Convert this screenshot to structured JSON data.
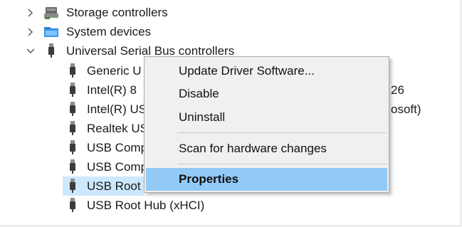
{
  "tree": {
    "top_partial_label": "",
    "storage_controllers": {
      "label": "Storage controllers",
      "chevron": "chevron-right-icon",
      "icon": "storage-controller-icon"
    },
    "system_devices": {
      "label": "System devices",
      "chevron": "chevron-right-icon",
      "icon": "system-devices-icon"
    },
    "usb_controllers": {
      "label": "Universal Serial Bus controllers",
      "chevron": "chevron-down-icon",
      "icon": "usb-plug-icon"
    },
    "children": [
      {
        "label": "Generic U",
        "overflow": "",
        "icon": "usb-plug-icon"
      },
      {
        "label": "Intel(R) 8",
        "overflow": "26",
        "icon": "usb-plug-icon"
      },
      {
        "label": "Intel(R) US",
        "overflow": "osoft)",
        "icon": "usb-plug-icon"
      },
      {
        "label": "Realtek US",
        "overflow": "",
        "icon": "usb-plug-icon"
      },
      {
        "label": "USB Comp",
        "overflow": "",
        "icon": "usb-plug-icon"
      },
      {
        "label": "USB Comp",
        "overflow": "",
        "icon": "usb-plug-icon"
      },
      {
        "label": "USB Root",
        "overflow": "",
        "icon": "usb-plug-icon",
        "selected": true
      },
      {
        "label": "USB Root Hub (xHCI)",
        "overflow": "",
        "icon": "usb-plug-icon"
      }
    ]
  },
  "context_menu": {
    "items": [
      {
        "label": "Update Driver Software..."
      },
      {
        "label": "Disable"
      },
      {
        "label": "Uninstall"
      },
      {
        "label": "Scan for hardware changes"
      },
      {
        "label": "Properties",
        "highlighted": true
      }
    ]
  },
  "colors": {
    "selection_bg": "#cce8ff",
    "menu_bg": "#f0f0f0",
    "menu_highlight": "#91c9f7",
    "text": "#1a1a1a"
  }
}
